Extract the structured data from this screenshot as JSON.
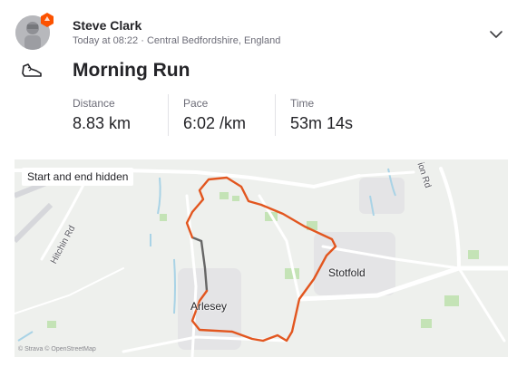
{
  "athlete": {
    "name": "Steve Clark",
    "meta": "Today at 08:22 · Central Bedfordshire, England"
  },
  "activity": {
    "type_icon": "running-shoe-icon",
    "title": "Morning Run"
  },
  "stats": {
    "distance": {
      "label": "Distance",
      "value": "8.83 km"
    },
    "pace": {
      "label": "Pace",
      "value": "6:02 /km"
    },
    "time": {
      "label": "Time",
      "value": "53m 14s"
    }
  },
  "map": {
    "privacy_label": "Start and end hidden",
    "towns": {
      "stotfold": "Stotfold",
      "arlesey": "Arlesey"
    },
    "roads": {
      "hitchin": "Hitchin Rd",
      "top_right": "ion Rd"
    },
    "attribution": "© Strava © OpenStreetMap",
    "colors": {
      "route": "#e2561f",
      "hidden_route": "#666666",
      "background": "#eef0ed",
      "roads": "#ffffff",
      "water": "#a9d3e6",
      "green": "#c4e3b6"
    }
  },
  "colors": {
    "accent": "#fc5200"
  }
}
